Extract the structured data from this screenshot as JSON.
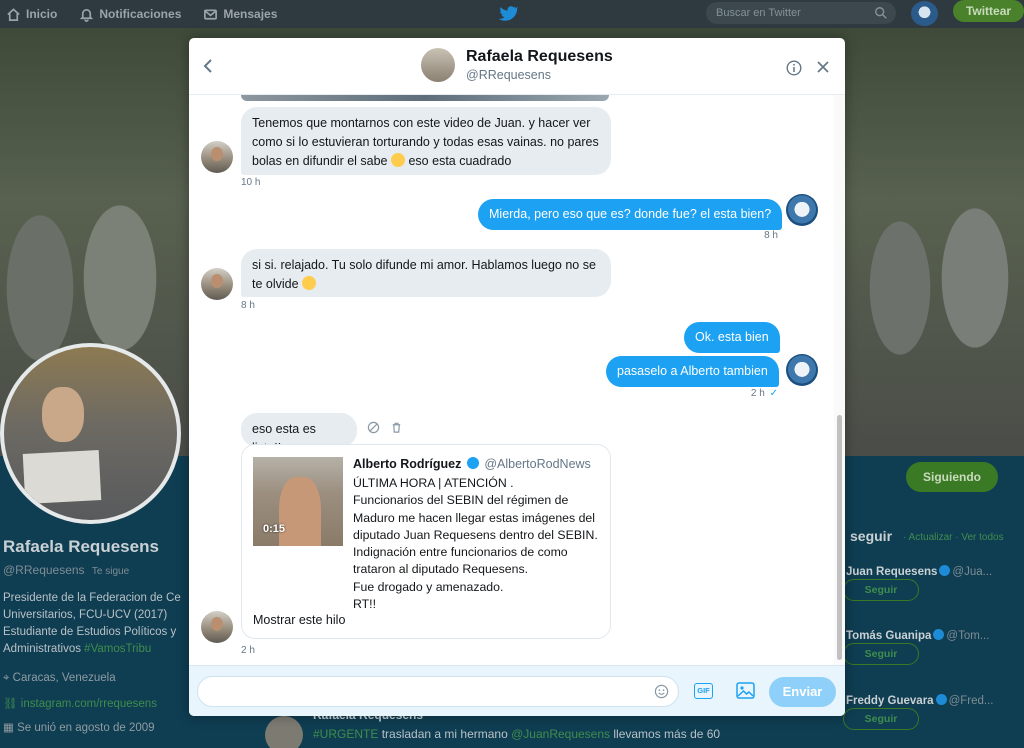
{
  "topbar": {
    "nav": [
      {
        "label": "Inicio",
        "icon": "home-icon"
      },
      {
        "label": "Notificaciones",
        "icon": "bell-icon"
      },
      {
        "label": "Mensajes",
        "icon": "mail-icon"
      }
    ],
    "search_placeholder": "Buscar en Twitter",
    "tweet_button": "Twittear"
  },
  "profile": {
    "name": "Rafaela Requesens",
    "handle": "@RRequesens",
    "follows_you": "Te sigue",
    "bio_line1": "Presidente de la Federacion de Ce",
    "bio_line2": "Universitarios, FCU-UCV (2017)",
    "bio_line3": "Estudiante de Estudios Políticos y",
    "bio_line4_text": "Administrativos",
    "bio_line4_tag": "#VamosTribu",
    "location": "Caracas, Venezuela",
    "link": "instagram.com/rrequesens",
    "joined": "Se unió en agosto de 2009",
    "following_button": "Siguiendo"
  },
  "feed": {
    "name": "Rafaela Requesens",
    "tag": "#URGENTE",
    "text": "trasladan a mi hermano",
    "mention": "@JuanRequesens",
    "text2": "llevamos más de 60"
  },
  "who_to_follow": {
    "title": "seguir",
    "actions": "· Actualizar · Ver todos",
    "items": [
      {
        "name": "Juan Requesens",
        "handle": "@Jua...",
        "button": "Seguir"
      },
      {
        "name": "Tomás Guanipa",
        "handle": "@Tom...",
        "button": "Seguir"
      },
      {
        "name": "Freddy Guevara",
        "handle": "@Fred...",
        "button": "Seguir"
      }
    ]
  },
  "dm": {
    "contact_name": "Rafaela Requesens",
    "contact_handle": "@RRequesens",
    "messages": [
      {
        "from": "them",
        "text": "Tenemos que montarnos con este video de Juan. y hacer ver como si lo estuvieran torturando y todas esas vainas. no pares bolas en difundir el sabe",
        "text_after_emoji": "eso esta cuadrado",
        "emoji": "crying-laughing-emoji",
        "time": "10 h"
      },
      {
        "from": "me",
        "text": "Mierda, pero eso que es? donde fue? el esta bien?",
        "time": "8 h"
      },
      {
        "from": "them",
        "text": "si si. relajado. Tu solo difunde mi amor. Hablamos luego no se te olvide",
        "emoji": "kiss-emoji",
        "time": "8 h"
      },
      {
        "from": "me",
        "text": "Ok. esta bien"
      },
      {
        "from": "me",
        "text": "pasaselo a Alberto tambien",
        "time": "2 h",
        "status": "✓"
      },
      {
        "from": "them",
        "text": "eso esta es listo!!"
      }
    ],
    "shared_tweet": {
      "author": "Alberto Rodríguez",
      "handle": "@AlbertoRodNews",
      "video_duration": "0:15",
      "text": "ÚLTIMA HORA | ATENCIÓN .\nFuncionarios del SEBIN del régimen de Maduro me hacen llegar estas imágenes del diputado Juan Requesens dentro del SEBIN.\nIndignación entre funcionarios de como trataron al diputado Requesens.\nFue drogado y amenazado.\nRT!!",
      "show_thread": "Mostrar este hilo",
      "time": "2 h"
    },
    "composer": {
      "placeholder": "",
      "gif_label": "GIF",
      "send_label": "Enviar"
    }
  },
  "colors": {
    "accent": "#1da1f2",
    "incoming_bubble": "#e6ecf0",
    "send_disabled": "#8ed0f9",
    "background_dim": "#0e3b4f"
  }
}
